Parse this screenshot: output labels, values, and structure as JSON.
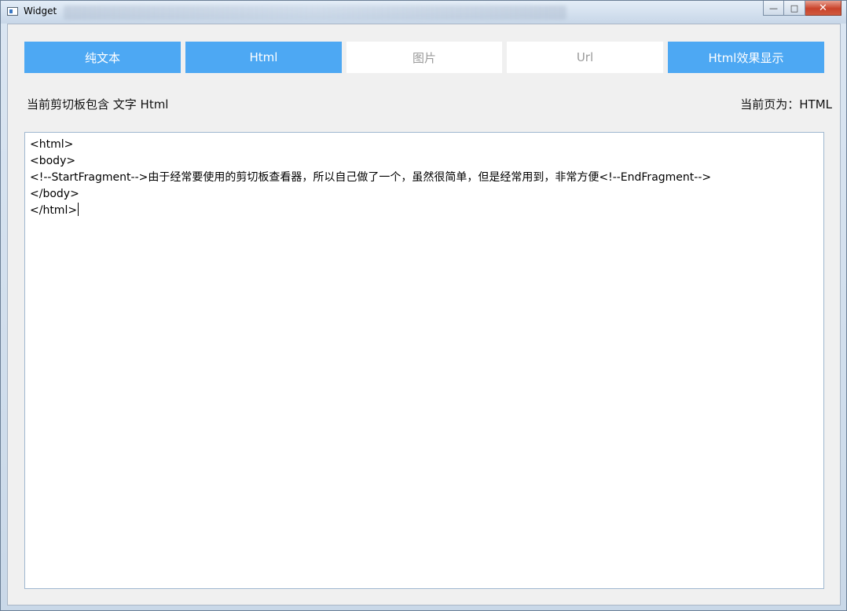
{
  "window": {
    "title": "Widget",
    "controls": {
      "minimize": "—",
      "maximize": "□",
      "close": "✕"
    }
  },
  "tabs": [
    {
      "label": "纯文本",
      "state": "active"
    },
    {
      "label": "Html",
      "state": "active"
    },
    {
      "label": "图片",
      "state": "inactive"
    },
    {
      "label": "Url",
      "state": "inactive"
    },
    {
      "label": "Html效果显示",
      "state": "active"
    }
  ],
  "status": {
    "clipboard_contains": "当前剪切板包含 文字 Html",
    "current_page": "当前页为：HTML"
  },
  "editor": {
    "lines": [
      "<html>",
      "<body>",
      "<!--StartFragment-->由于经常要使用的剪切板查看器，所以自己做了一个，虽然很简单，但是经常用到，非常方便<!--EndFragment-->",
      "</body>",
      "</html>"
    ]
  },
  "colors": {
    "active_tab": "#4da8f3",
    "inactive_tab_text": "#9a9a9a",
    "client_bg": "#f0f0f0"
  }
}
